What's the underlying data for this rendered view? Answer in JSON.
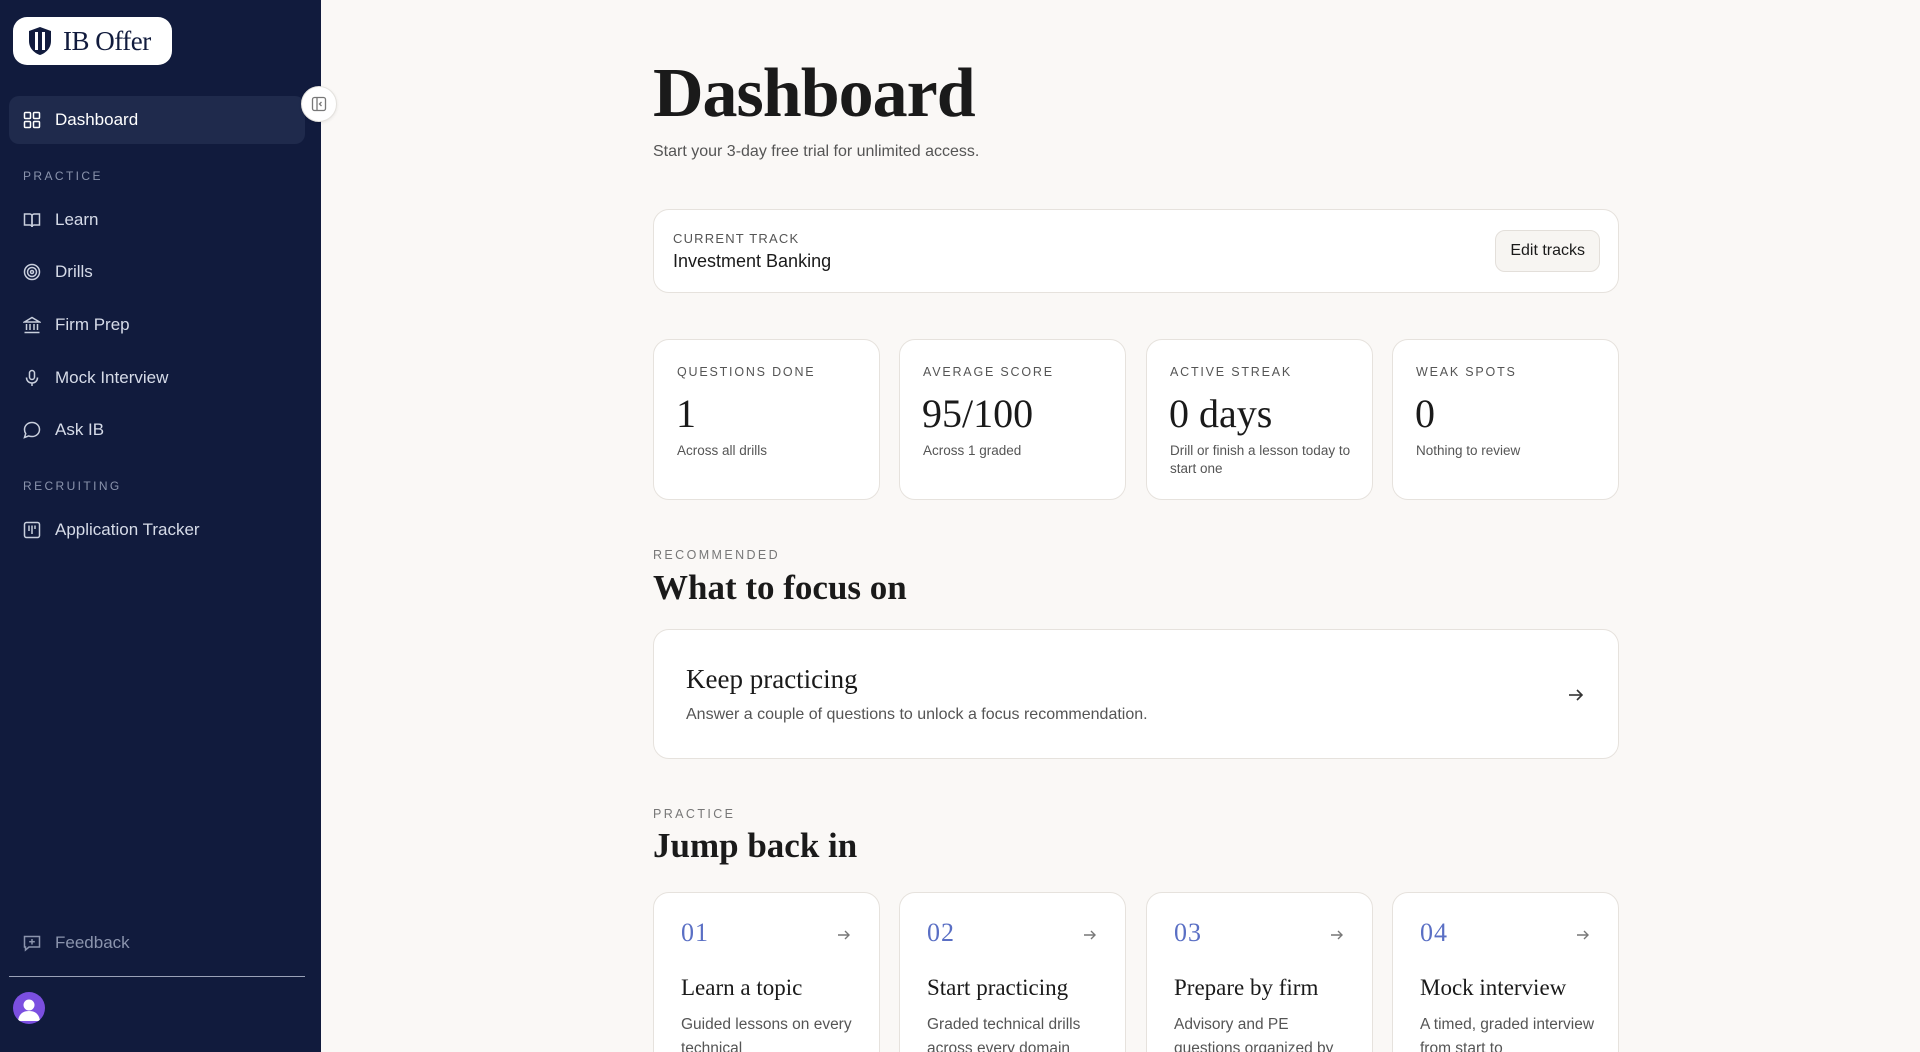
{
  "app": {
    "name": "IB Offer"
  },
  "sidebar": {
    "nav_top": {
      "label": "Dashboard",
      "icon": "grid-icon"
    },
    "practice_label": "PRACTICE",
    "practice_items": [
      {
        "label": "Learn",
        "icon": "book-icon"
      },
      {
        "label": "Drills",
        "icon": "target-icon"
      },
      {
        "label": "Firm Prep",
        "icon": "bank-icon"
      },
      {
        "label": "Mock Interview",
        "icon": "microphone-icon"
      },
      {
        "label": "Ask IB",
        "icon": "chat-bubble-icon"
      }
    ],
    "recruiting_label": "RECRUITING",
    "recruiting_items": [
      {
        "label": "Application Tracker",
        "icon": "kanban-icon"
      }
    ],
    "feedback_label": "Feedback"
  },
  "main": {
    "title": "Dashboard",
    "subtitle": "Start your 3-day free trial for unlimited access.",
    "track": {
      "label": "CURRENT TRACK",
      "value": "Investment Banking",
      "edit_label": "Edit tracks"
    },
    "stats": [
      {
        "label": "QUESTIONS DONE",
        "value": "1",
        "note": "Across all drills"
      },
      {
        "label": "AVERAGE SCORE",
        "value": "95/100",
        "note": "Across 1 graded"
      },
      {
        "label": "ACTIVE STREAK",
        "value": "0 days",
        "note": "Drill or finish a lesson today to start one"
      },
      {
        "label": "WEAK SPOTS",
        "value": "0",
        "note": "Nothing to review"
      }
    ],
    "recommended": {
      "eyebrow": "RECOMMENDED",
      "title": "What to focus on",
      "card_title": "Keep practicing",
      "card_desc": "Answer a couple of questions to unlock a focus recommendation."
    },
    "practice": {
      "eyebrow": "PRACTICE",
      "title": "Jump back in",
      "cards": [
        {
          "num": "01",
          "title": "Learn a topic",
          "desc": "Guided lessons on every technical"
        },
        {
          "num": "02",
          "title": "Start practicing",
          "desc": "Graded technical drills across every domain"
        },
        {
          "num": "03",
          "title": "Prepare by firm",
          "desc": "Advisory and PE questions organized by"
        },
        {
          "num": "04",
          "title": "Mock interview",
          "desc": "A timed, graded interview from start to"
        }
      ]
    }
  }
}
